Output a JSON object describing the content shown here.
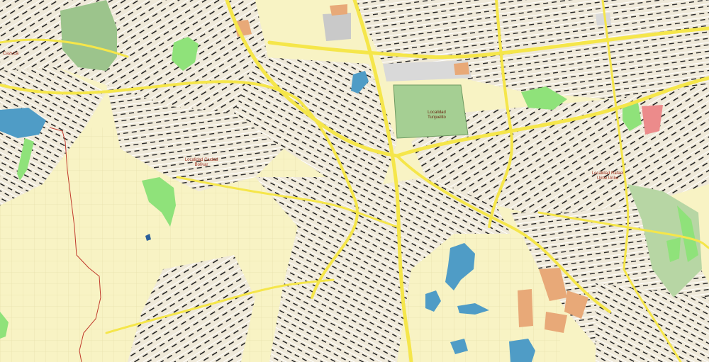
{
  "map": {
    "type": "street-map",
    "colors": {
      "land": "#f8f3c4",
      "urban": "#efe9d9",
      "road_major": "#f5e64a",
      "road_minor": "#ffffff",
      "street_labels": "#1a1a1a",
      "park": "#8fe27a",
      "forest": "#9cc48c",
      "water": "#4f9cc6",
      "boundary": "#c0392b",
      "industrial": "#e8a978",
      "campus": "#d9d9d9",
      "label_text": "#9a2b17"
    },
    "labels": {
      "cazuca": "Cazucá",
      "tunjuelito_1": "Localidad",
      "tunjuelito_2": "Tunjuelito",
      "bolivar_1": "Localidad Ciudad",
      "bolivar_2": "Bolívar",
      "rafael_1": "Localidad Rafael",
      "rafael_2": "Uribe Uribe"
    }
  }
}
